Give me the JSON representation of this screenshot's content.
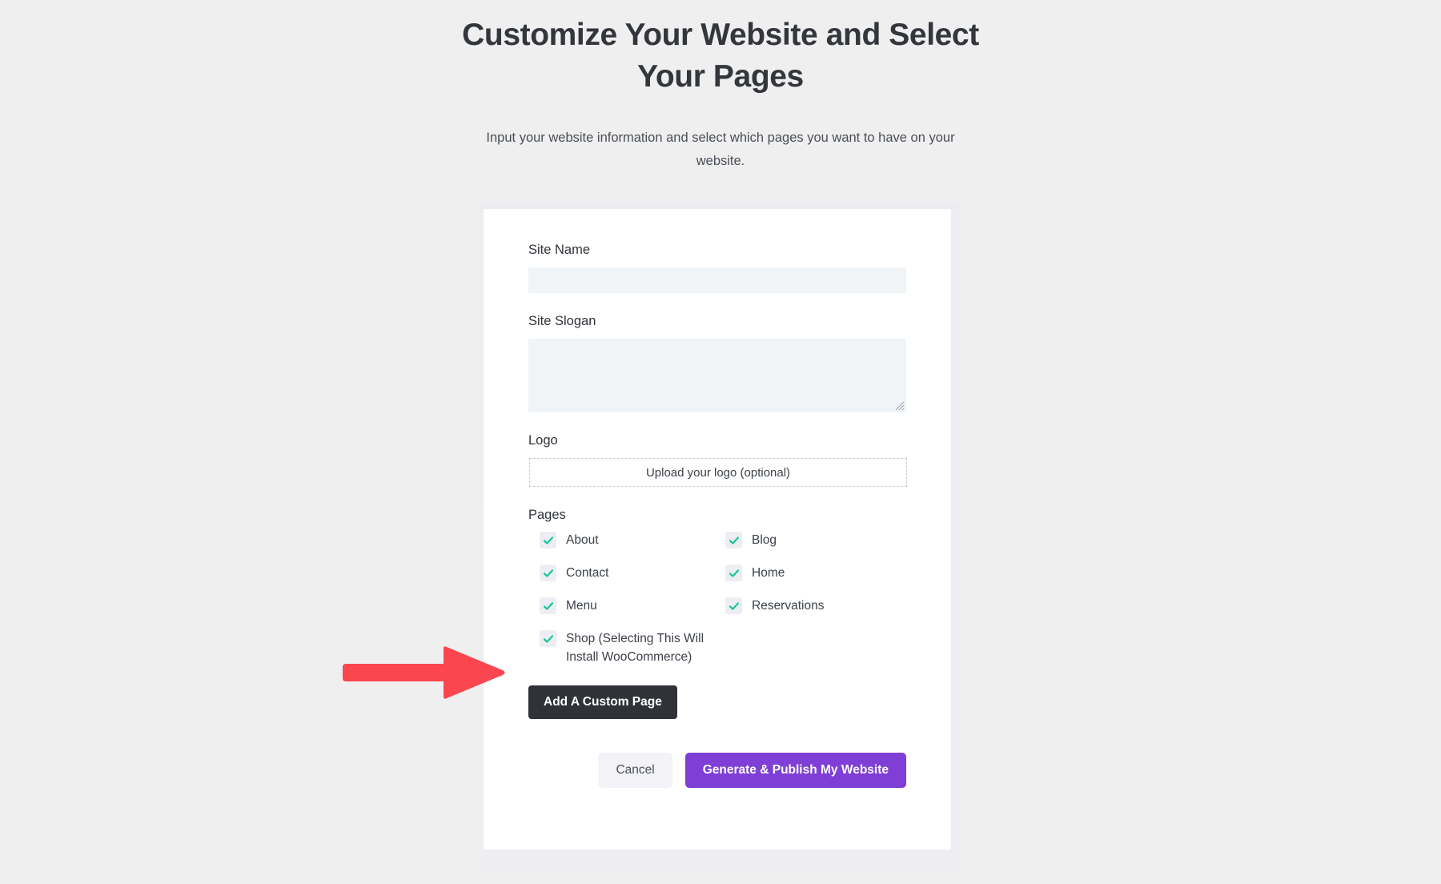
{
  "header": {
    "title": "Customize Your Website and Select Your Pages",
    "subtitle": "Input your website information and select which pages you want to have on your website."
  },
  "form": {
    "site_name": {
      "label": "Site Name",
      "value": "",
      "placeholder": ""
    },
    "site_slogan": {
      "label": "Site Slogan",
      "value": "",
      "placeholder": ""
    },
    "logo": {
      "label": "Logo",
      "upload_text": "Upload your logo (optional)"
    },
    "pages": {
      "label": "Pages",
      "items": [
        {
          "label": "About",
          "checked": true
        },
        {
          "label": "Blog",
          "checked": true
        },
        {
          "label": "Contact",
          "checked": true
        },
        {
          "label": "Home",
          "checked": true
        },
        {
          "label": "Menu",
          "checked": true
        },
        {
          "label": "Reservations",
          "checked": true
        },
        {
          "label": "Shop (Selecting This Will Install WooCommerce)",
          "checked": true
        }
      ]
    },
    "add_custom_page_label": "Add A Custom Page"
  },
  "actions": {
    "cancel_label": "Cancel",
    "primary_label": "Generate & Publish My Website"
  },
  "annotation": {
    "arrow": "right-arrow-annotation"
  },
  "colors": {
    "page_background": "#efeff0",
    "card_background": "#ffffff",
    "input_background": "#f1f4f7",
    "checkbox_background": "#eceef3",
    "checkmark": "#16c79a",
    "dark_button": "#2f3338",
    "primary_button": "#7f3fd6",
    "cancel_button": "#f3f3f7",
    "heading_text": "#33363b",
    "body_text": "#4a4f57",
    "arrow_red": "#fb4650"
  }
}
